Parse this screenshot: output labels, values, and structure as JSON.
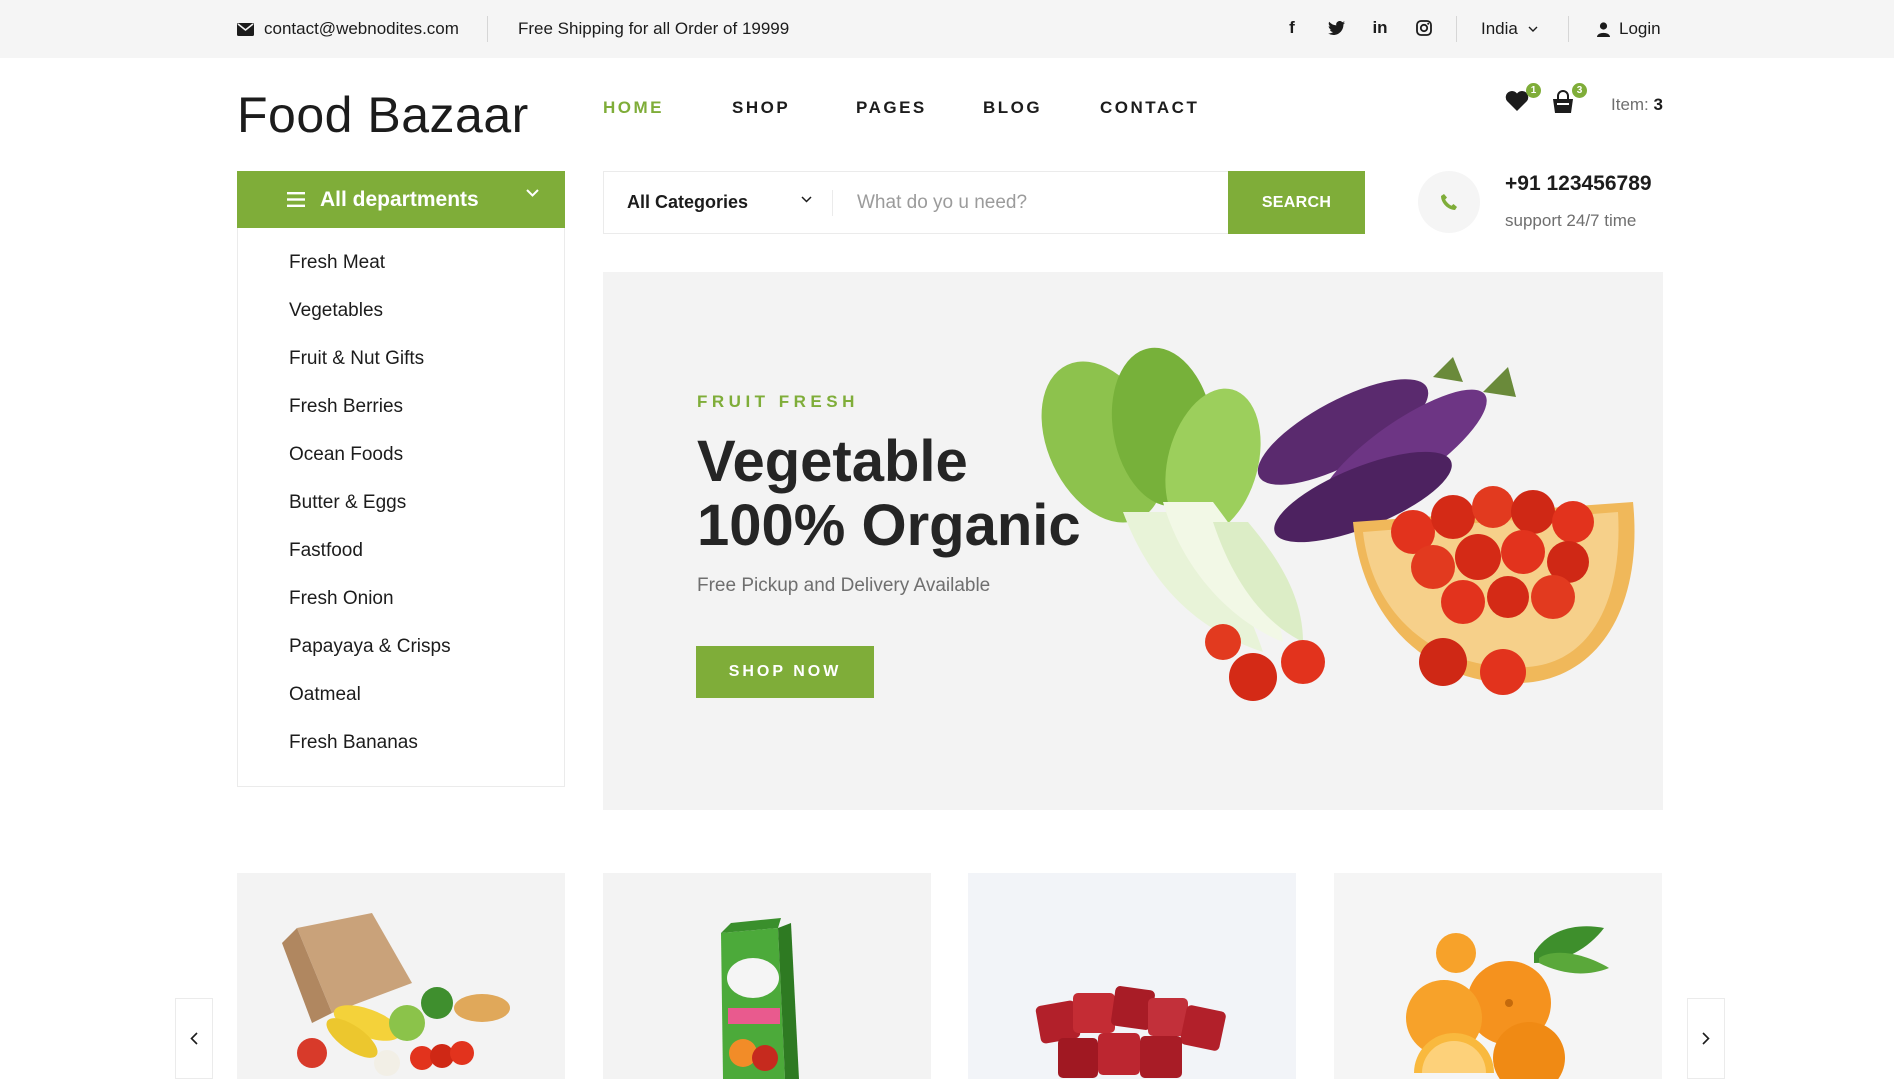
{
  "topbar": {
    "email": "contact@webnodites.com",
    "shipping": "Free Shipping for all Order of 19999",
    "social_icons": [
      "facebook-icon",
      "twitter-icon",
      "linkedin-icon",
      "instagram-icon"
    ],
    "language": "India",
    "login": "Login"
  },
  "header": {
    "logo": "Food Bazaar",
    "nav": [
      {
        "label": "HOME",
        "active": true
      },
      {
        "label": "SHOP",
        "active": false
      },
      {
        "label": "PAGES",
        "active": false
      },
      {
        "label": "BLOG",
        "active": false
      },
      {
        "label": "CONTACT",
        "active": false
      }
    ],
    "wishlist_count": "1",
    "cart_count": "3",
    "items_label": "Item:",
    "items_value": "3"
  },
  "departments": {
    "title": "All departments",
    "items": [
      "Fresh Meat",
      "Vegetables",
      "Fruit & Nut Gifts",
      "Fresh Berries",
      "Ocean Foods",
      "Butter & Eggs",
      "Fastfood",
      "Fresh Onion",
      "Papayaya & Crisps",
      "Oatmeal",
      "Fresh Bananas"
    ]
  },
  "search": {
    "category": "All Categories",
    "placeholder": "What do yo u need?",
    "button": "SEARCH"
  },
  "contact": {
    "phone": "+91 123456789",
    "support": "support 24/7 time"
  },
  "hero": {
    "eyebrow": "FRUIT FRESH",
    "title_line1": "Vegetable",
    "title_line2": "100% Organic",
    "subtitle": "Free Pickup and Delivery Available",
    "button": "SHOP NOW"
  },
  "colors": {
    "accent": "#7fad39",
    "text": "#1c1c1c",
    "muted": "#6f6f6f",
    "panel": "#f3f3f3"
  }
}
